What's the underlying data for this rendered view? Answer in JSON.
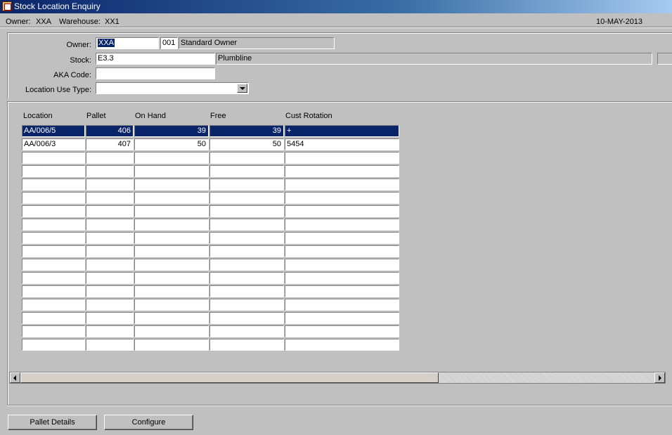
{
  "window": {
    "title": "Stock Location Enquiry"
  },
  "infobar": {
    "owner_label": "Owner:",
    "owner_value": "XXA",
    "warehouse_label": "Warehouse:",
    "warehouse_value": "XX1",
    "date": "10-MAY-2013"
  },
  "form": {
    "owner_label": "Owner:",
    "owner_value": "XXA",
    "owner_code": "001",
    "owner_name": "Standard Owner",
    "stock_label": "Stock:",
    "stock_value": "E3.3",
    "stock_desc": "Plumbline",
    "aka_label": "AKA Code:",
    "aka_value": "",
    "loc_use_label": "Location Use Type:",
    "loc_use_value": ""
  },
  "grid": {
    "columns": [
      "Location",
      "Pallet",
      "On Hand",
      "Free",
      "Cust Rotation"
    ],
    "rows": [
      [
        "AA/006/5",
        "406",
        "39",
        "39",
        "+"
      ],
      [
        "AA/006/3",
        "407",
        "50",
        "50",
        "5454"
      ]
    ],
    "total_rows": 17,
    "selected_row": 0
  },
  "scrollbar": {
    "position_fraction": 0.0,
    "visible_fraction": 0.66
  },
  "buttons": {
    "pallet_details": "Pallet Details",
    "configure": "Configure"
  },
  "colors": {
    "selection": "#0a246a",
    "window_bg": "#c0c0c0"
  },
  "icons": [
    "app-icon",
    "dropdown-arrow-icon",
    "scroll-left-icon",
    "scroll-right-icon"
  ]
}
